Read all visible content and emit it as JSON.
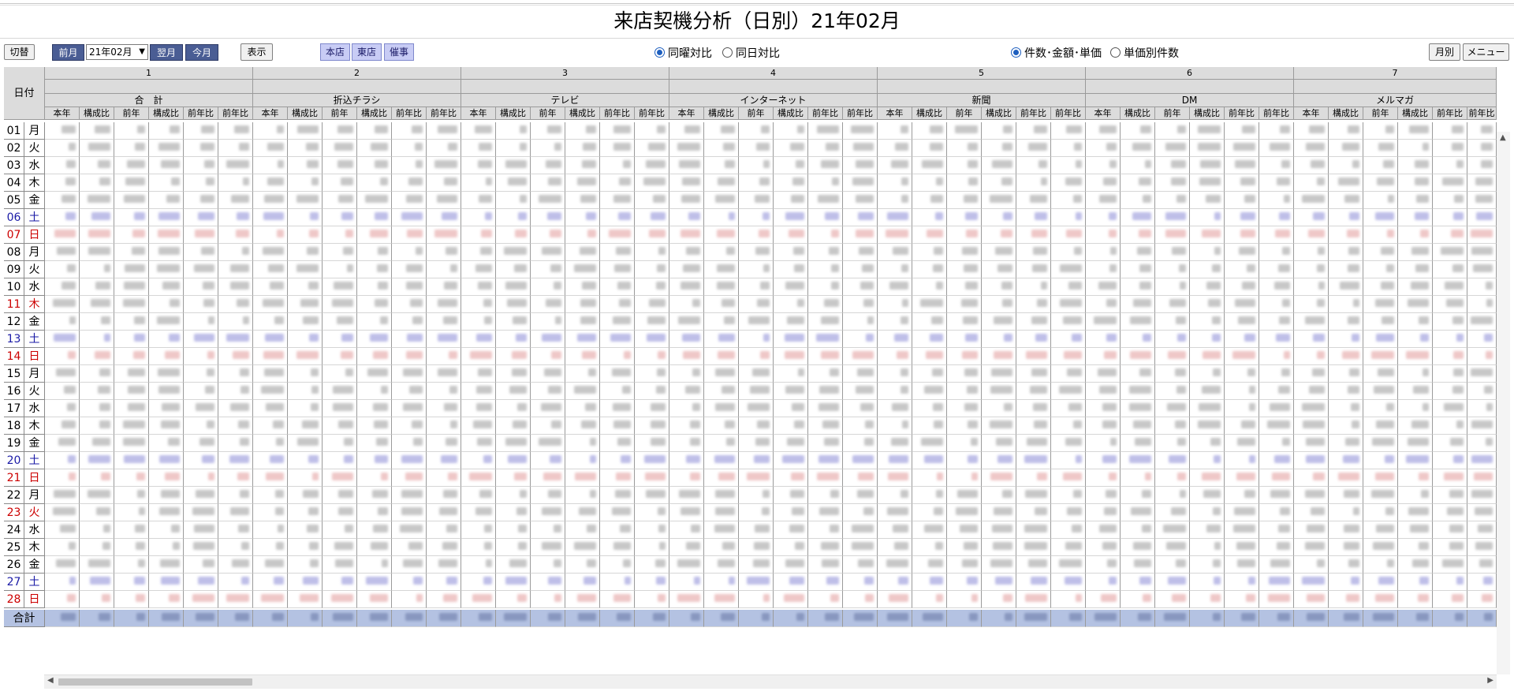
{
  "page": {
    "title": "来店契機分析（日別）21年02月"
  },
  "toolbar": {
    "switch_label": "切替",
    "prev_label": "前月",
    "month_value": "21年02月",
    "next_label": "翌月",
    "this_month_label": "今月",
    "show_label": "表示",
    "stores": [
      "本店",
      "東店",
      "催事"
    ],
    "compare_options": [
      {
        "label": "同曜対比",
        "selected": true
      },
      {
        "label": "同日対比",
        "selected": false
      }
    ],
    "mode_options": [
      {
        "label": "件数･金額･単価",
        "selected": true
      },
      {
        "label": "単価別件数",
        "selected": false
      }
    ],
    "monthly_label": "月別",
    "menu_label": "メニュー"
  },
  "table": {
    "day_header": "日付",
    "groups": [
      {
        "no": "1",
        "name": "合　計"
      },
      {
        "no": "2",
        "name": "折込チラシ"
      },
      {
        "no": "3",
        "name": "テレビ"
      },
      {
        "no": "4",
        "name": "インターネット"
      },
      {
        "no": "5",
        "name": "新聞"
      },
      {
        "no": "6",
        "name": "DM"
      },
      {
        "no": "7",
        "name": "メルマガ"
      }
    ],
    "sub_columns": [
      "本年",
      "構成比",
      "前年",
      "構成比",
      "前年比",
      "前年比"
    ],
    "rows": [
      {
        "day": "01",
        "wd": "月",
        "type": "weekday"
      },
      {
        "day": "02",
        "wd": "火",
        "type": "weekday"
      },
      {
        "day": "03",
        "wd": "水",
        "type": "weekday"
      },
      {
        "day": "04",
        "wd": "木",
        "type": "weekday"
      },
      {
        "day": "05",
        "wd": "金",
        "type": "weekday"
      },
      {
        "day": "06",
        "wd": "土",
        "type": "saturday"
      },
      {
        "day": "07",
        "wd": "日",
        "type": "sunday"
      },
      {
        "day": "08",
        "wd": "月",
        "type": "weekday"
      },
      {
        "day": "09",
        "wd": "火",
        "type": "weekday"
      },
      {
        "day": "10",
        "wd": "水",
        "type": "weekday"
      },
      {
        "day": "11",
        "wd": "木",
        "type": "holiday"
      },
      {
        "day": "12",
        "wd": "金",
        "type": "weekday"
      },
      {
        "day": "13",
        "wd": "土",
        "type": "saturday"
      },
      {
        "day": "14",
        "wd": "日",
        "type": "sunday"
      },
      {
        "day": "15",
        "wd": "月",
        "type": "weekday"
      },
      {
        "day": "16",
        "wd": "火",
        "type": "weekday"
      },
      {
        "day": "17",
        "wd": "水",
        "type": "weekday"
      },
      {
        "day": "18",
        "wd": "木",
        "type": "weekday"
      },
      {
        "day": "19",
        "wd": "金",
        "type": "weekday"
      },
      {
        "day": "20",
        "wd": "土",
        "type": "saturday"
      },
      {
        "day": "21",
        "wd": "日",
        "type": "sunday"
      },
      {
        "day": "22",
        "wd": "月",
        "type": "weekday"
      },
      {
        "day": "23",
        "wd": "火",
        "type": "holiday"
      },
      {
        "day": "24",
        "wd": "水",
        "type": "weekday"
      },
      {
        "day": "25",
        "wd": "木",
        "type": "weekday"
      },
      {
        "day": "26",
        "wd": "金",
        "type": "weekday"
      },
      {
        "day": "27",
        "wd": "土",
        "type": "saturday"
      },
      {
        "day": "28",
        "wd": "日",
        "type": "sunday"
      }
    ],
    "total_label": "合計",
    "colors": {
      "weekday": "#000000",
      "saturday": "#1a1aa6",
      "sunday": "#cc0000",
      "holiday": "#cc0000"
    }
  }
}
